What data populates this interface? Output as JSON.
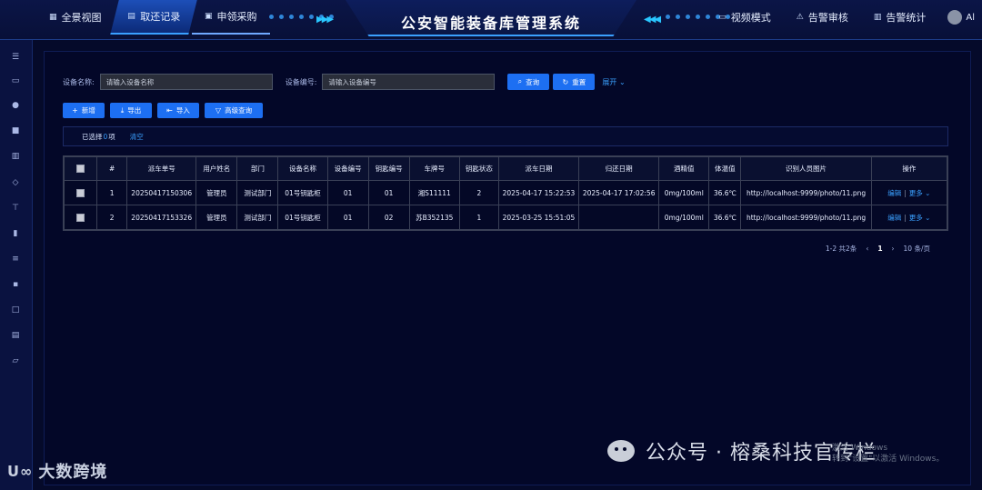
{
  "header": {
    "title": "公安智能装备库管理系统",
    "nav_left": [
      {
        "label": "全景视图",
        "icon": "grid-icon",
        "glyph": "▦"
      },
      {
        "label": "取还记录",
        "icon": "list-icon",
        "glyph": "▤"
      },
      {
        "label": "申领采购",
        "icon": "cart-icon",
        "glyph": "▣"
      }
    ],
    "nav_right": [
      {
        "label": "视频模式",
        "icon": "video-icon",
        "glyph": "▭"
      },
      {
        "label": "告警审核",
        "icon": "warning-icon",
        "glyph": "⚠"
      },
      {
        "label": "告警统计",
        "icon": "chart-icon",
        "glyph": "▥"
      }
    ],
    "user": "Al"
  },
  "search": {
    "device_name_label": "设备名称:",
    "device_name_placeholder": "请输入设备名称",
    "device_code_label": "设备编号:",
    "device_code_placeholder": "请输入设备编号",
    "query_label": "查询",
    "reset_label": "重置",
    "expand_label": "展开"
  },
  "toolbar": {
    "add_label": "新增",
    "export_label": "导出",
    "import_label": "导入",
    "advanced_label": "高级查询"
  },
  "selection": {
    "prefix": "已选择",
    "count": "0",
    "suffix": "项",
    "clear_label": "清空"
  },
  "table": {
    "headers": [
      "#",
      "派车单号",
      "用户姓名",
      "部门",
      "设备名称",
      "设备编号",
      "钥匙编号",
      "车牌号",
      "钥匙状态",
      "派车日期",
      "归还日期",
      "酒精值",
      "体温值",
      "识别人员图片",
      "操作"
    ],
    "rows": [
      {
        "index": "1",
        "order": "20250417150306",
        "user": "管理员",
        "dept": "测试部门",
        "device": "01号钥匙柜",
        "device_code": "01",
        "key_code": "01",
        "plate": "湘S11111",
        "key_status": "2",
        "dispatch_date": "2025-04-17 15:22:53",
        "return_date": "2025-04-17 17:02:56",
        "alcohol": "0mg/100ml",
        "temp": "36.6℃",
        "photo": "http://localhost:9999/photo/11.png",
        "edit": "编辑",
        "more": "更多"
      },
      {
        "index": "2",
        "order": "20250417153326",
        "user": "管理员",
        "dept": "测试部门",
        "device": "01号钥匙柜",
        "device_code": "01",
        "key_code": "02",
        "plate": "苏B352135",
        "key_status": "1",
        "dispatch_date": "2025-03-25 15:51:05",
        "return_date": "",
        "alcohol": "0mg/100ml",
        "temp": "36.6℃",
        "photo": "http://localhost:9999/photo/11.png",
        "edit": "编辑",
        "more": "更多"
      }
    ]
  },
  "pagination": {
    "summary": "1-2 共2条",
    "current": "1",
    "page_size": "10 条/页"
  },
  "watermark": {
    "left": "大数跨境",
    "right": "公众号 · 榕桑科技官传栏",
    "activate_line1": "激活 Windows",
    "activate_line2": "转到\"设置\"以激活 Windows。"
  },
  "colors": {
    "accent": "#1d6ff2",
    "link": "#3aa0ff",
    "background": "#050a2a",
    "panel": "#030728"
  }
}
